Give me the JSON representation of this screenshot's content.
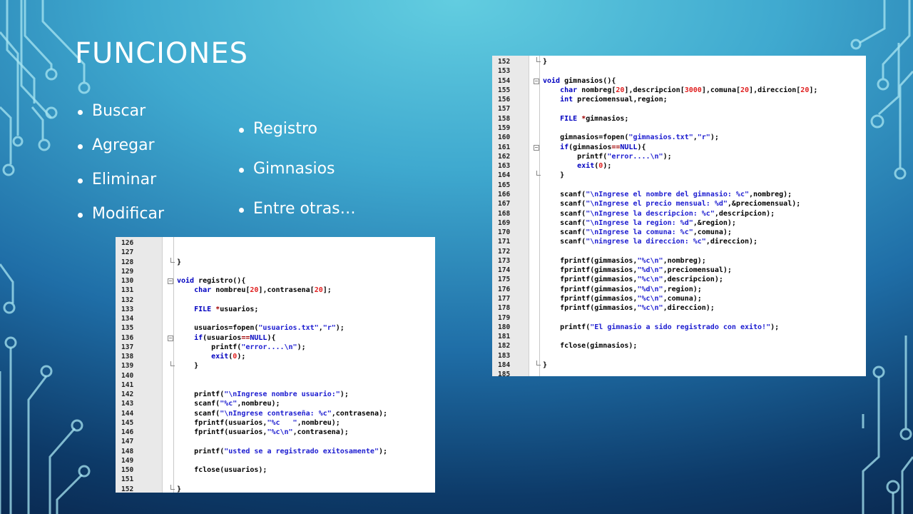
{
  "slide": {
    "title": "FUNCIONES",
    "bullets_left": [
      "Buscar",
      "Agregar",
      "Eliminar",
      "Modificar"
    ],
    "bullets_right": [
      "Registro",
      "Gimnasios",
      "Entre otras…"
    ]
  },
  "colors": {
    "title_text": "#ffffff",
    "keyword": "#0000c0",
    "string": "#1c1cd0",
    "number": "#e02020",
    "code_background": "#ffffff",
    "gutter_background": "#e9e9e9"
  },
  "code_registro": {
    "lines": [
      {
        "n": "126",
        "code": ""
      },
      {
        "n": "127",
        "code": ""
      },
      {
        "n": "128",
        "code": "}",
        "fold": "end"
      },
      {
        "n": "129",
        "code": ""
      },
      {
        "n": "130",
        "code": "void registro(){",
        "fold": "start"
      },
      {
        "n": "131",
        "code": "    char nombreu[20],contrasena[20];"
      },
      {
        "n": "132",
        "code": ""
      },
      {
        "n": "133",
        "code": "    FILE *usuarios;"
      },
      {
        "n": "134",
        "code": ""
      },
      {
        "n": "135",
        "code": "    usuarios=fopen(\"usuarios.txt\",\"r\");"
      },
      {
        "n": "136",
        "code": "    if(usuarios==NULL){",
        "fold": "start"
      },
      {
        "n": "137",
        "code": "        printf(\"error....\\n\");"
      },
      {
        "n": "138",
        "code": "        exit(0);"
      },
      {
        "n": "139",
        "code": "    }",
        "fold": "end"
      },
      {
        "n": "140",
        "code": ""
      },
      {
        "n": "141",
        "code": ""
      },
      {
        "n": "142",
        "code": "    printf(\"\\nIngrese nombre usuario:\");"
      },
      {
        "n": "143",
        "code": "    scanf(\"%c\",nombreu);"
      },
      {
        "n": "144",
        "code": "    scanf(\"\\nIngrese contraseña: %c\",contrasena);"
      },
      {
        "n": "145",
        "code": "    fprintf(usuarios,\"%c   \",nombreu);"
      },
      {
        "n": "146",
        "code": "    fprintf(usuarios,\"%c\\n\",contrasena);"
      },
      {
        "n": "147",
        "code": ""
      },
      {
        "n": "148",
        "code": "    printf(\"usted se a registrado exitosamente\");"
      },
      {
        "n": "149",
        "code": ""
      },
      {
        "n": "150",
        "code": "    fclose(usuarios);"
      },
      {
        "n": "151",
        "code": ""
      },
      {
        "n": "152",
        "code": "}",
        "fold": "end"
      }
    ]
  },
  "code_gimnasios": {
    "lines": [
      {
        "n": "152",
        "code": "}",
        "fold": "end"
      },
      {
        "n": "153",
        "code": ""
      },
      {
        "n": "154",
        "code": "void gimnasios(){",
        "fold": "start"
      },
      {
        "n": "155",
        "code": "    char nombreg[20],descripcion[3000],comuna[20],direccion[20];"
      },
      {
        "n": "156",
        "code": "    int preciomensual,region;"
      },
      {
        "n": "157",
        "code": ""
      },
      {
        "n": "158",
        "code": "    FILE *gimnasios;"
      },
      {
        "n": "159",
        "code": ""
      },
      {
        "n": "160",
        "code": "    gimnasios=fopen(\"gimnasios.txt\",\"r\");"
      },
      {
        "n": "161",
        "code": "    if(gimnasios==NULL){",
        "fold": "start"
      },
      {
        "n": "162",
        "code": "        printf(\"error....\\n\");"
      },
      {
        "n": "163",
        "code": "        exit(0);"
      },
      {
        "n": "164",
        "code": "    }",
        "fold": "end"
      },
      {
        "n": "165",
        "code": ""
      },
      {
        "n": "166",
        "code": "    scanf(\"\\nIngrese el nombre del gimnasio: %c\",nombreg);"
      },
      {
        "n": "167",
        "code": "    scanf(\"\\nIngrese el precio mensual: %d\",&preciomensual);"
      },
      {
        "n": "168",
        "code": "    scanf(\"\\nIngrese la descripcion: %c\",descripcion);"
      },
      {
        "n": "169",
        "code": "    scanf(\"\\nIngrese la region: %d\",&region);"
      },
      {
        "n": "170",
        "code": "    scanf(\"\\nIngrese la comuna: %c\",comuna);"
      },
      {
        "n": "171",
        "code": "    scanf(\"\\ningrese la direccion: %c\",direccion);"
      },
      {
        "n": "172",
        "code": ""
      },
      {
        "n": "173",
        "code": "    fprintf(gimmasios,\"%c\\n\",nombreg);"
      },
      {
        "n": "174",
        "code": "    fprintf(gimmasios,\"%d\\n\",preciomensual);"
      },
      {
        "n": "175",
        "code": "    fprintf(gimmasios,\"%c\\n\",descripcion);"
      },
      {
        "n": "176",
        "code": "    fprintf(gimmasios,\"%d\\n\",region);"
      },
      {
        "n": "177",
        "code": "    fprintf(gimmasios,\"%c\\n\",comuna);"
      },
      {
        "n": "178",
        "code": "    fprintf(gimmasios,\"%c\\n\",direccion);"
      },
      {
        "n": "179",
        "code": ""
      },
      {
        "n": "180",
        "code": "    printf(\"El gimnasio a sido registrado con exito!\");"
      },
      {
        "n": "181",
        "code": ""
      },
      {
        "n": "182",
        "code": "    fclose(gimnasios);"
      },
      {
        "n": "183",
        "code": ""
      },
      {
        "n": "184",
        "code": "}",
        "fold": "end"
      },
      {
        "n": "185",
        "code": ""
      }
    ]
  }
}
